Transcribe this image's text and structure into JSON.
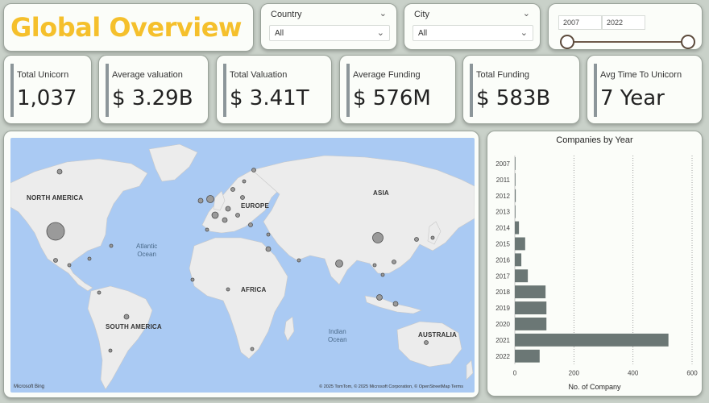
{
  "header": {
    "title": "Global Overview"
  },
  "filters": {
    "country": {
      "label": "Country",
      "value": "All"
    },
    "city": {
      "label": "City",
      "value": "All"
    },
    "year_range": {
      "start": "2007",
      "end": "2022"
    }
  },
  "kpis": [
    {
      "label": "Total Unicorn",
      "value": "1,037"
    },
    {
      "label": "Average valuation",
      "value": "$ 3.29B"
    },
    {
      "label": "Total Valuation",
      "value": "$ 3.41T"
    },
    {
      "label": "Average Funding",
      "value": "$ 576M"
    },
    {
      "label": "Total Funding",
      "value": "$ 583B"
    },
    {
      "label": "Avg Time To Unicorn",
      "value": "7 Year"
    }
  ],
  "map": {
    "continents": [
      "NORTH AMERICA",
      "EUROPE",
      "ASIA",
      "AFRICA",
      "SOUTH AMERICA",
      "AUSTRALIA"
    ],
    "oceans": [
      "Atlantic\nOcean",
      "Indian\nOcean"
    ],
    "attribution": "© 2025 TomTom, © 2025 Microsoft Corporation, © OpenStreetMap  Terms",
    "logo": "Microsoft Bing"
  },
  "chart_data": {
    "type": "bar",
    "orientation": "horizontal",
    "title": "Companies by Year",
    "xlabel": "No. of Company",
    "ylabel": "",
    "categories": [
      "2007",
      "2011",
      "2012",
      "2013",
      "2014",
      "2015",
      "2016",
      "2017",
      "2018",
      "2019",
      "2020",
      "2021",
      "2022"
    ],
    "values": [
      1,
      1,
      3,
      1,
      14,
      35,
      22,
      44,
      104,
      107,
      107,
      520,
      84
    ],
    "xlim": [
      0,
      600
    ],
    "xticks": [
      0,
      200,
      400,
      600
    ],
    "grid": true,
    "bar_color": "#6b7775"
  }
}
